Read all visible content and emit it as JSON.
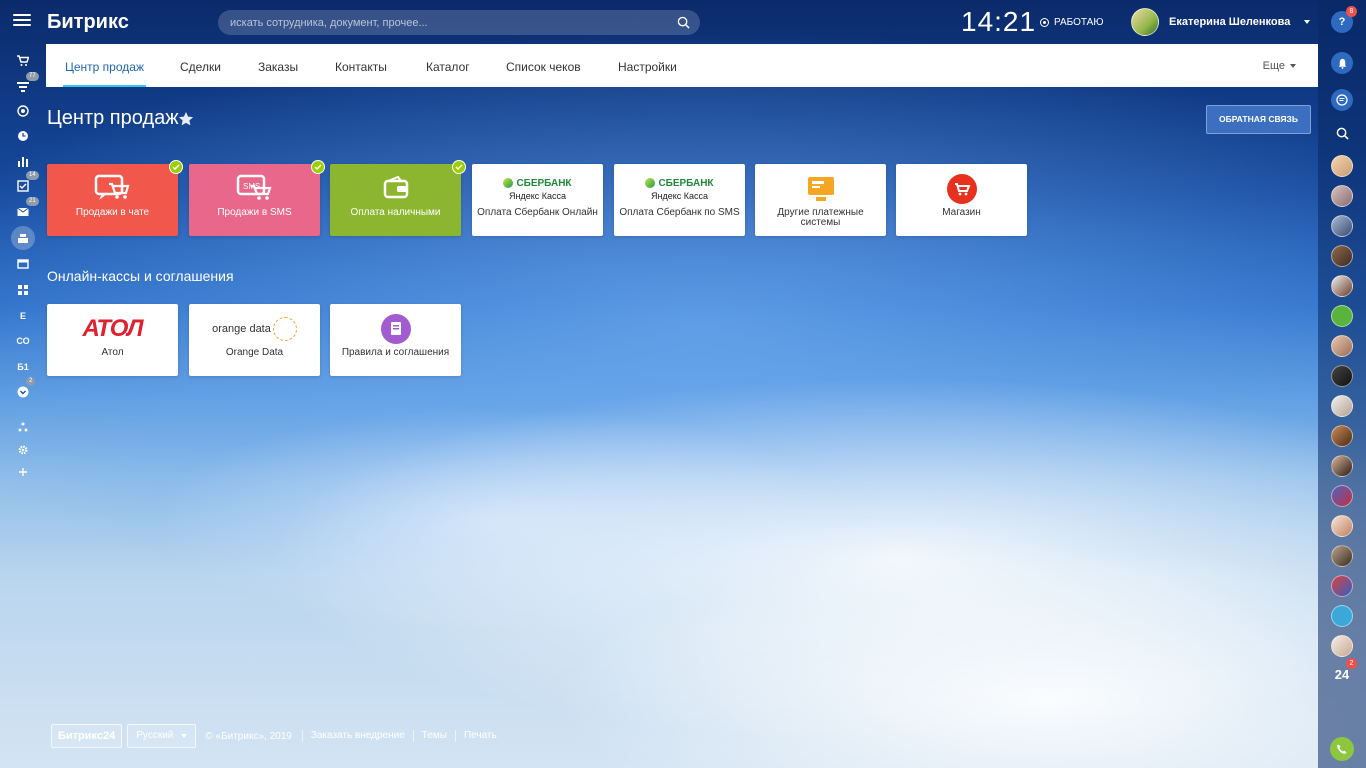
{
  "topbar": {
    "logo": "Битрикс",
    "search_placeholder": "искать сотрудника, документ, прочее...",
    "clock": "14:21",
    "status": "РАБОТАЮ",
    "user_name": "Екатерина Шеленкова"
  },
  "tabs": {
    "items": [
      "Центр продаж",
      "Сделки",
      "Заказы",
      "Контакты",
      "Каталог",
      "Список чеков",
      "Настройки"
    ],
    "more": "Еще"
  },
  "left_sidebar": {
    "badges": {
      "filter": "77",
      "tasks": "14",
      "mail": "21",
      "check": "2"
    },
    "text_items": [
      "Е",
      "СО",
      "Б1"
    ]
  },
  "right_sidebar": {
    "help_badge": "8",
    "b24_label": "24",
    "b24_badge": "2"
  },
  "page": {
    "title": "Центр продаж",
    "feedback_button": "ОБРАТНАЯ СВЯЗЬ",
    "payment_tiles": [
      {
        "label": "Продажи в чате",
        "icon": "chat-cart-icon",
        "color": "#f2574b",
        "checked": true
      },
      {
        "label": "Продажи в SMS",
        "icon": "sms-cart-icon",
        "color": "#e8678a",
        "checked": true
      },
      {
        "label": "Оплата наличными",
        "icon": "wallet-icon",
        "color": "#8db630",
        "checked": true
      },
      {
        "label": "Оплата Сбербанк Онлайн",
        "icon": "sberbank-logo",
        "checked": false
      },
      {
        "label": "Оплата Сбербанк по SMS",
        "icon": "sberbank-logo",
        "checked": false
      },
      {
        "label": "Другие платежные системы",
        "icon": "terminal-icon",
        "checked": false
      },
      {
        "label": "Магазин",
        "icon": "shop-cart-icon",
        "checked": false
      }
    ],
    "sber_brand": "СБЕРБАНК",
    "yandex_kassa": "Яндекс Касса",
    "section_title": "Онлайн-кассы и соглашения",
    "kassa_tiles": [
      {
        "label": "Атол",
        "logo_text": "АТОЛ"
      },
      {
        "label": "Orange Data",
        "logo_text": "orange data"
      },
      {
        "label": "Правила и соглашения",
        "icon": "document-icon"
      }
    ]
  },
  "footer": {
    "logo": "Битрикс24",
    "language": "Русский",
    "copyright": "© «Битрикс», 2019",
    "links": [
      "Заказать внедрение",
      "Темы",
      "Печать"
    ]
  },
  "colors": {
    "accent": "#2fc6f6",
    "active_tab": "#2067b0",
    "check": "#9dcf00",
    "badge_red": "#f0504a"
  }
}
